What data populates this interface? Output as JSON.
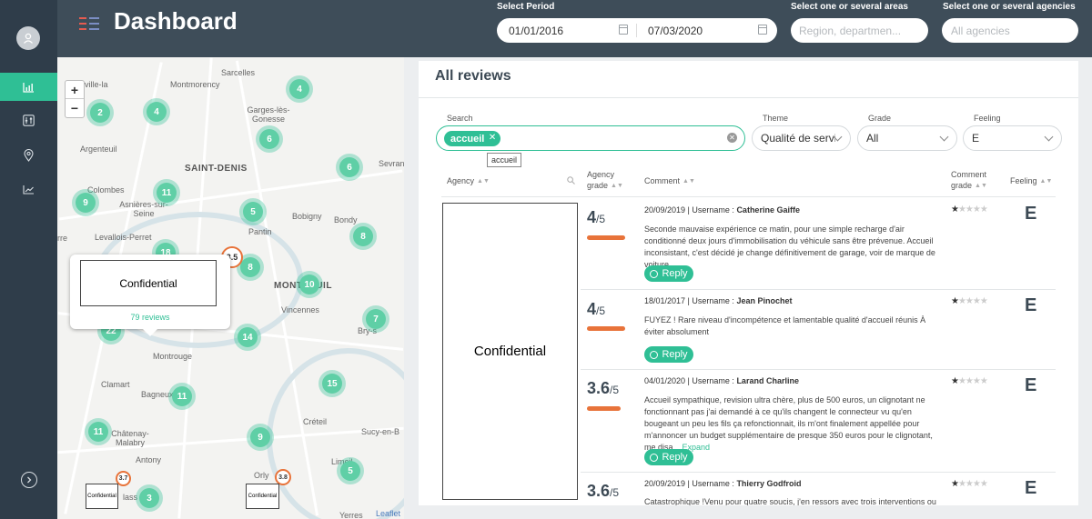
{
  "header": {
    "title": "Dashboard",
    "period_label": "Select Period",
    "date_from": "01/01/2016",
    "date_to": "07/03/2020",
    "areas_label": "Select one or several areas",
    "areas_placeholder": "Region, departmen...",
    "agencies_label": "Select one or several agencies",
    "agencies_placeholder": "All agencies"
  },
  "sidebar": {
    "items": [
      {
        "icon": "bar-chart-icon",
        "active": true
      },
      {
        "icon": "sliders-icon",
        "active": false
      },
      {
        "icon": "map-pin-icon",
        "active": false
      },
      {
        "icon": "trend-line-icon",
        "active": false
      }
    ],
    "exit_icon": "chevron-right-circle-icon"
  },
  "map": {
    "labels": [
      "Sarcelles",
      "Montmorency",
      "ville-la",
      "Garges-lès-Gonesse",
      "Argenteuil",
      "SAINT-DENIS",
      "Sevran",
      "Colombes",
      "Asnières-sur-Seine",
      "Bobigny",
      "Bondy",
      "Pantin",
      "Levallois-Perret",
      "rre",
      "MONTREUIL",
      "Vincennes",
      "Bry-s",
      "Montrouge",
      "Clamart",
      "Bagneux",
      "Créteil",
      "Sucy-en-B",
      "Châtenay-Malabry",
      "Antony",
      "Orly",
      "Limeil",
      "lass",
      "Yerres"
    ],
    "clusters": [
      "2",
      "4",
      "4",
      "6",
      "6",
      "11",
      "9",
      "5",
      "8",
      "18",
      "8",
      "10",
      "7",
      "22",
      "14",
      "15",
      "11",
      "11",
      "9",
      "5",
      "3"
    ],
    "rating_badges": [
      "3.5",
      "3.7",
      "3.8"
    ],
    "popup_name": "Confidential",
    "popup_reviews": "79 reviews",
    "small_confidential": "Confidential",
    "attribution": "Leaflet",
    "zoom_in": "+",
    "zoom_out": "−"
  },
  "reviews": {
    "title": "All reviews",
    "filters": {
      "search_label": "Search",
      "search_chip": "accueil",
      "search_tooltip": "accueil",
      "theme_label": "Theme",
      "theme_value": "Qualité de servic",
      "grade_label": "Grade",
      "grade_value": "All",
      "feeling_label": "Feeling",
      "feeling_value": "E"
    },
    "columns": {
      "agency": "Agency",
      "agency_grade_1": "Agency",
      "agency_grade_2": "grade",
      "comment": "Comment",
      "comment_grade_1": "Comment",
      "comment_grade_2": "grade",
      "feeling": "Feeling"
    },
    "agency_name": "Confidential",
    "reply_label": "Reply",
    "expand_label": "Expand",
    "rows": [
      {
        "grade": "4",
        "grade_max": "/5",
        "grade_value": 4,
        "date": "20/09/2019",
        "username_label": "Username :",
        "username": "Catherine Gaiffe",
        "text": "Seconde mauvaise expérience ce matin, pour une simple recharge d'air conditionné deux jours d'immobilisation du véhicule sans être prévenue. Accueil inconsistant, c'est décidé je change définitivement de garage, voir de marque de voiture....",
        "stars": 1,
        "feeling": "E"
      },
      {
        "grade": "4",
        "grade_max": "/5",
        "grade_value": 4,
        "date": "18/01/2017",
        "username_label": "Username :",
        "username": "Jean Pinochet",
        "text": "FUYEZ ! Rare niveau d'incompétence et lamentable qualité d'accueil réunis À éviter absolument",
        "stars": 1,
        "feeling": "E"
      },
      {
        "grade": "3.6",
        "grade_max": "/5",
        "grade_value": 3.6,
        "date": "04/01/2020",
        "username_label": "Username :",
        "username": "Larand Charline",
        "text": "Accueil sympathique, revision ultra chère, plus de 500 euros, un clignotant ne fonctionnant pas j'ai demandé à ce qu'ils changent le connecteur vu qu'en bougeant un peu les fils ça refonctionnait, ils m'ont finalement appellée pour m'annoncer un budget supplémentaire de presque 350 euros pour le clignotant, me disa...",
        "stars": 1,
        "feeling": "E"
      },
      {
        "grade": "3.6",
        "grade_max": "/5",
        "grade_value": 3.6,
        "date": "20/09/2019",
        "username_label": "Username :",
        "username": "Thierry Godfroid",
        "text": "Catastrophique !Venu pour quatre soucis, j'en ressors avec trois interventions ou",
        "stars": 1,
        "feeling": "E"
      }
    ]
  },
  "colors": {
    "accent": "#2fbf95",
    "sidebar": "#2f3d4a",
    "header": "#3e4d59",
    "grade_bar": "#e8733a"
  }
}
